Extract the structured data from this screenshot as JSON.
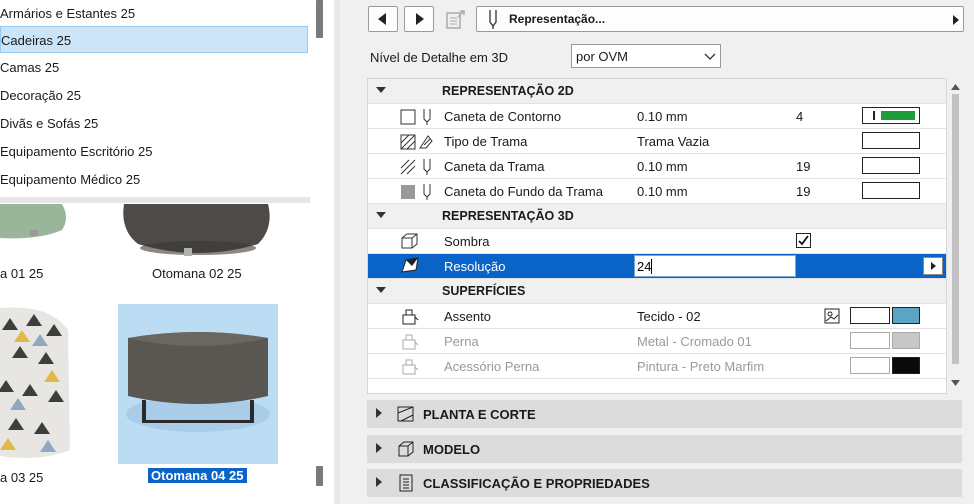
{
  "categories": [
    {
      "label": "Armários e Estantes 25"
    },
    {
      "label": "Cadeiras 25"
    },
    {
      "label": "Camas 25"
    },
    {
      "label": "Decoração 25"
    },
    {
      "label": "Divãs e Sofás 25"
    },
    {
      "label": "Equipamento Escritório 25"
    },
    {
      "label": "Equipamento Médico 25"
    }
  ],
  "selected_category": "Cadeiras 25",
  "gallery": [
    {
      "label": "a 01 25"
    },
    {
      "label": "Otomana 02 25"
    },
    {
      "label": "a 03 25"
    },
    {
      "label": "Otomana 04 25"
    }
  ],
  "header": {
    "title": "Representação..."
  },
  "detail": {
    "label": "Nível de Detalhe em 3D",
    "value": "por OVM"
  },
  "sections": {
    "rep2d": "REPRESENTAÇÃO 2D",
    "rep3d": "REPRESENTAÇÃO 3D",
    "surfaces": "SUPERFÍCIES"
  },
  "rows": {
    "contour": {
      "name": "Caneta de Contorno",
      "value": "0.10 mm",
      "num": "4"
    },
    "hatch_type": {
      "name": "Tipo de Trama",
      "value": "Trama Vazia"
    },
    "hatch_pen": {
      "name": "Caneta da Trama",
      "value": "0.10 mm",
      "num": "19"
    },
    "hatch_bg": {
      "name": "Caneta do Fundo da Trama",
      "value": "0.10 mm",
      "num": "19"
    },
    "shadow": {
      "name": "Sombra",
      "checked": true
    },
    "resolution": {
      "name": "Resolução",
      "value": "24"
    },
    "seat": {
      "name": "Assento",
      "value": "Tecido - 02",
      "color": "#5ba4c4"
    },
    "leg": {
      "name": "Perna",
      "value": "Metal - Cromado 01",
      "color": "#c8c8c8"
    },
    "leg_acc": {
      "name": "Acessório Perna",
      "value": "Pintura - Preto Marfim",
      "color": "#0a0a0a"
    }
  },
  "panels": {
    "plan": "PLANTA E CORTE",
    "model": "MODELO",
    "classification": "CLASSIFICAÇÃO E PROPRIEDADES"
  },
  "colors": {
    "accent": "#0a64c8",
    "pen_green": "#1e9e3a"
  }
}
